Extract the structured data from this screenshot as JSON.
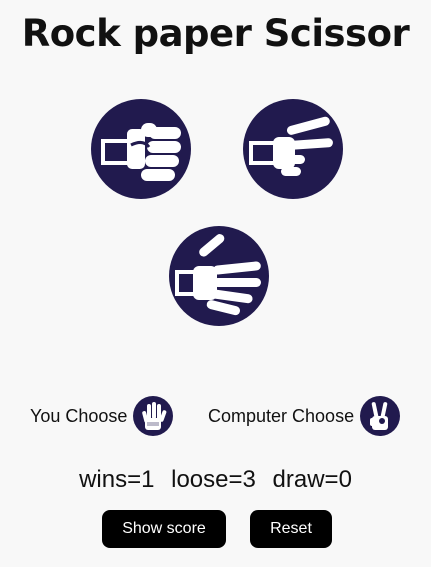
{
  "title": "Rock paper Scissor",
  "choices": [
    {
      "name": "rock",
      "icon": "fist-icon"
    },
    {
      "name": "scissors",
      "icon": "peace-hand-icon"
    },
    {
      "name": "paper",
      "icon": "open-hand-icon"
    }
  ],
  "user": {
    "label": "You Choose",
    "choice_icon": "open-hand-icon"
  },
  "computer": {
    "label": "Computer Choose",
    "choice_icon": "peace-hand-icon"
  },
  "score": {
    "wins": "wins=1",
    "loose": "loose=3",
    "draw": "draw=0"
  },
  "buttons": {
    "show_score": "Show score",
    "reset": "Reset"
  },
  "colors": {
    "icon_bg": "#211a4e",
    "button_bg": "#000000",
    "page_bg": "#f8f8f8"
  }
}
